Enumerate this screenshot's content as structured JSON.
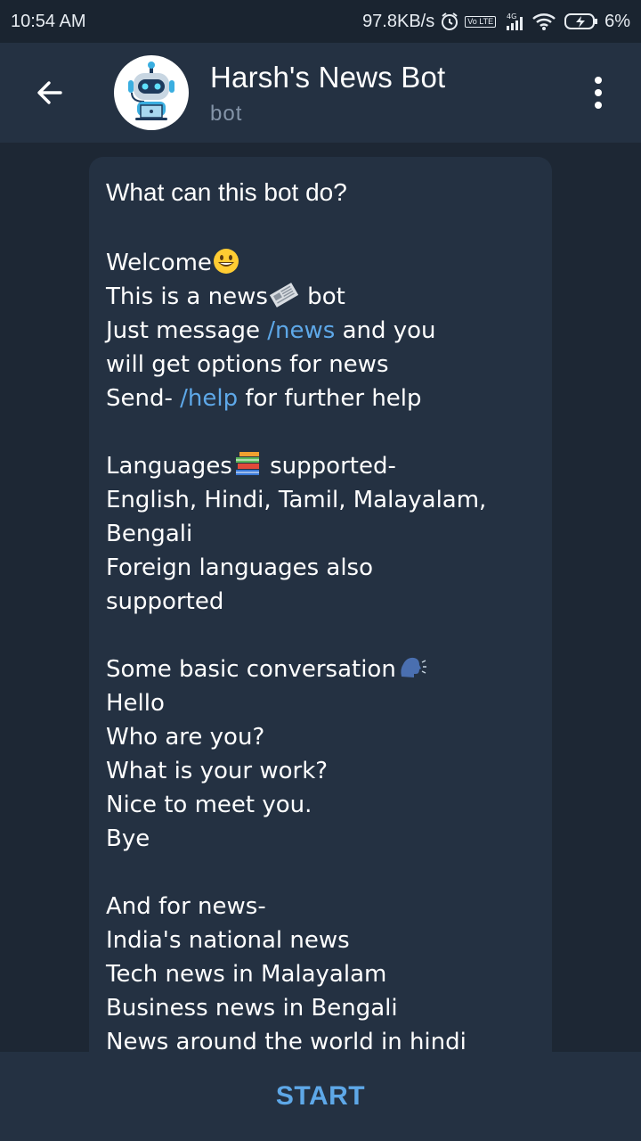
{
  "status": {
    "time": "10:54 AM",
    "speed": "97.8KB/s",
    "network": "4G",
    "volte": "Vo LTE",
    "battery_pct": "6%"
  },
  "header": {
    "title": "Harsh's News Bot",
    "subtitle": "bot"
  },
  "message": {
    "title": "What can this bot do?",
    "lines": [
      {
        "text": "Welcome",
        "emoji": "grinning-face"
      },
      {
        "pre": "This is a news",
        "emoji": "newspaper",
        "post": " bot"
      },
      {
        "pre": "Just message ",
        "cmd": "/news",
        "post": " and you"
      },
      {
        "text": "will get options for news"
      },
      {
        "pre": "Send- ",
        "cmd": "/help",
        "post": " for further help"
      },
      {
        "text": ""
      },
      {
        "pre": "Languages",
        "emoji": "books",
        "post": " supported-"
      },
      {
        "text": "English, Hindi, Tamil, Malayalam,"
      },
      {
        "text": "Bengali"
      },
      {
        "text": "Foreign languages also"
      },
      {
        "text": "supported"
      },
      {
        "text": ""
      },
      {
        "pre": "Some basic conversation",
        "emoji": "speaking-head"
      },
      {
        "text": "Hello"
      },
      {
        "text": "Who are you?"
      },
      {
        "text": "What is your work?"
      },
      {
        "text": "Nice to meet you."
      },
      {
        "text": "Bye"
      },
      {
        "text": ""
      },
      {
        "text": "And for news-"
      },
      {
        "text": "India's national news"
      },
      {
        "text": "Tech news in Malayalam"
      },
      {
        "text": "Business news in Bengali"
      },
      {
        "text": "News around the world in hindi"
      }
    ]
  },
  "footer": {
    "start_label": "START"
  },
  "colors": {
    "background": "#1d2734",
    "header": "#243142",
    "bubble": "#243142",
    "link": "#5ea8e8",
    "subtitle": "#8494a8"
  }
}
